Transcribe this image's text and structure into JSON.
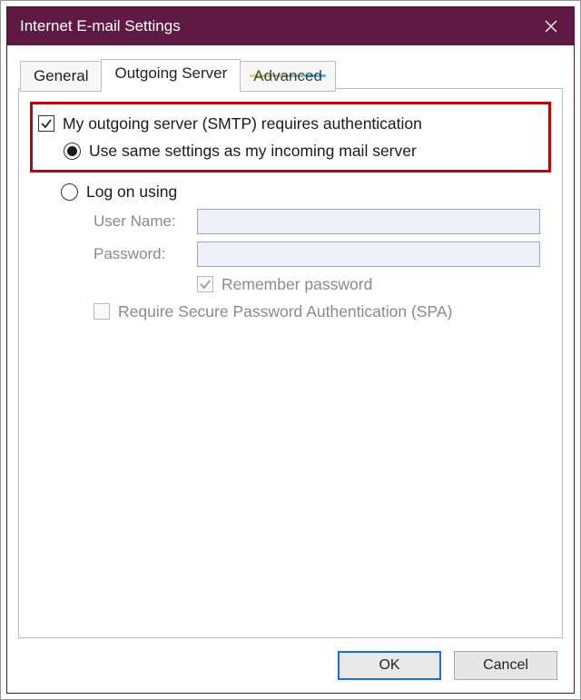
{
  "window": {
    "title": "Internet E-mail Settings"
  },
  "tabs": {
    "general": "General",
    "outgoing": "Outgoing Server",
    "advanced": "Advanced",
    "active": "outgoing"
  },
  "form": {
    "requires_auth_label": "My outgoing server (SMTP) requires authentication",
    "requires_auth_checked": true,
    "use_same_settings_label": "Use same settings as my incoming mail server",
    "log_on_using_label": "Log on using",
    "selected_option": "use_same",
    "username_label": "User Name:",
    "username_value": "",
    "password_label": "Password:",
    "password_value": "",
    "remember_password_label": "Remember password",
    "remember_password_checked": true,
    "require_spa_label": "Require Secure Password Authentication (SPA)",
    "require_spa_checked": false
  },
  "buttons": {
    "ok": "OK",
    "cancel": "Cancel"
  }
}
